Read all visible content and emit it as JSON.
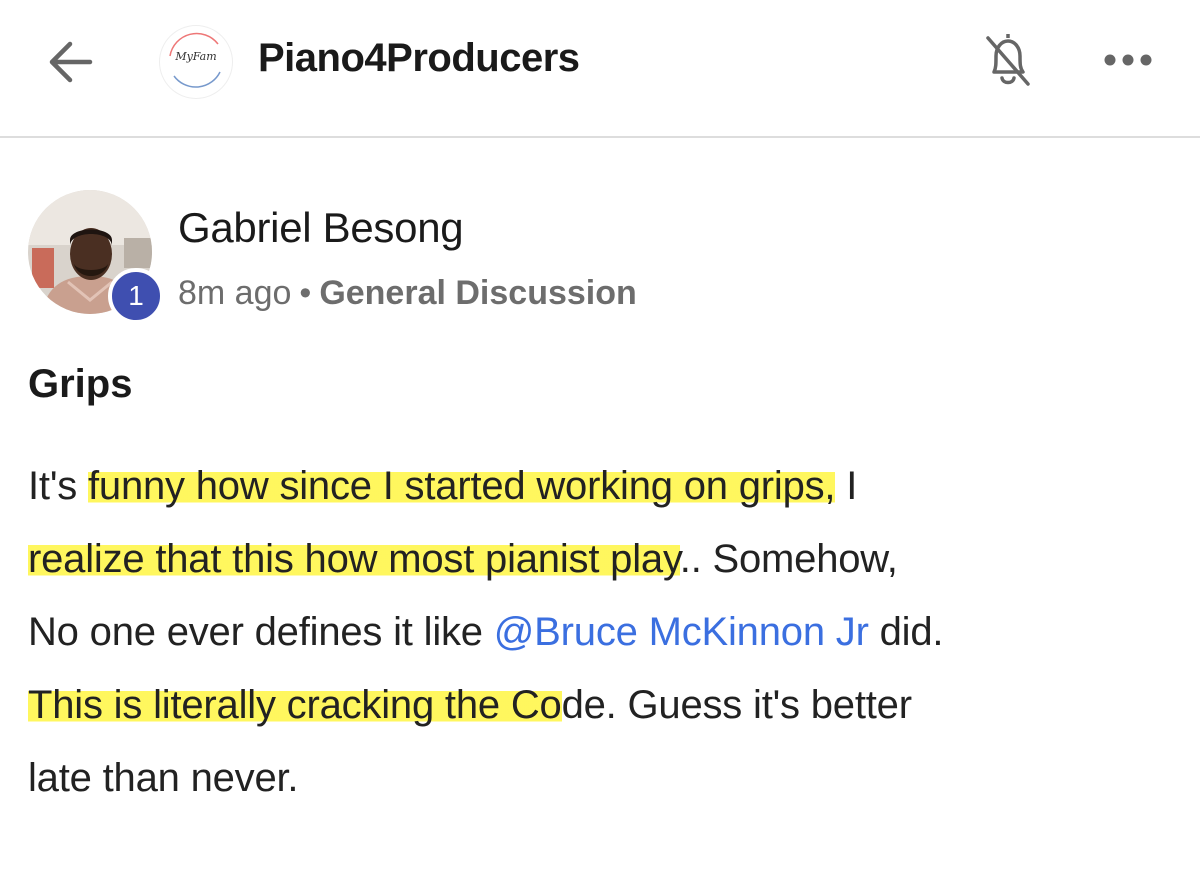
{
  "header": {
    "back_icon": "arrow-left-icon",
    "group_logo_text": "MyFam",
    "group_name": "Piano4Producers",
    "bell_icon": "bell-off-icon",
    "more_icon": "more-horizontal-icon"
  },
  "post": {
    "author": {
      "name": "Gabriel Besong",
      "level": "1"
    },
    "time": "8m ago",
    "separator": "•",
    "category": "General Discussion",
    "title": "Grips",
    "body": {
      "l1_a": "It's ",
      "l1_hl": "funny how since I started working on grips,",
      "l1_b": " I",
      "l2_hl": "realize that this how most pianist play",
      "l2_b": ".. Somehow,",
      "l3_a": "No one ever defines it like ",
      "l3_mention": "@Bruce McKinnon Jr",
      "l3_b": " did.",
      "l4_hl": "This is literally cracking the Co",
      "l4_b": "de. Guess it's better",
      "l5": "late than never."
    }
  },
  "colors": {
    "highlight": "#fff650",
    "mention": "#3b6fe0",
    "badge": "#3f4fb0",
    "meta_text": "#6d6d6d"
  }
}
